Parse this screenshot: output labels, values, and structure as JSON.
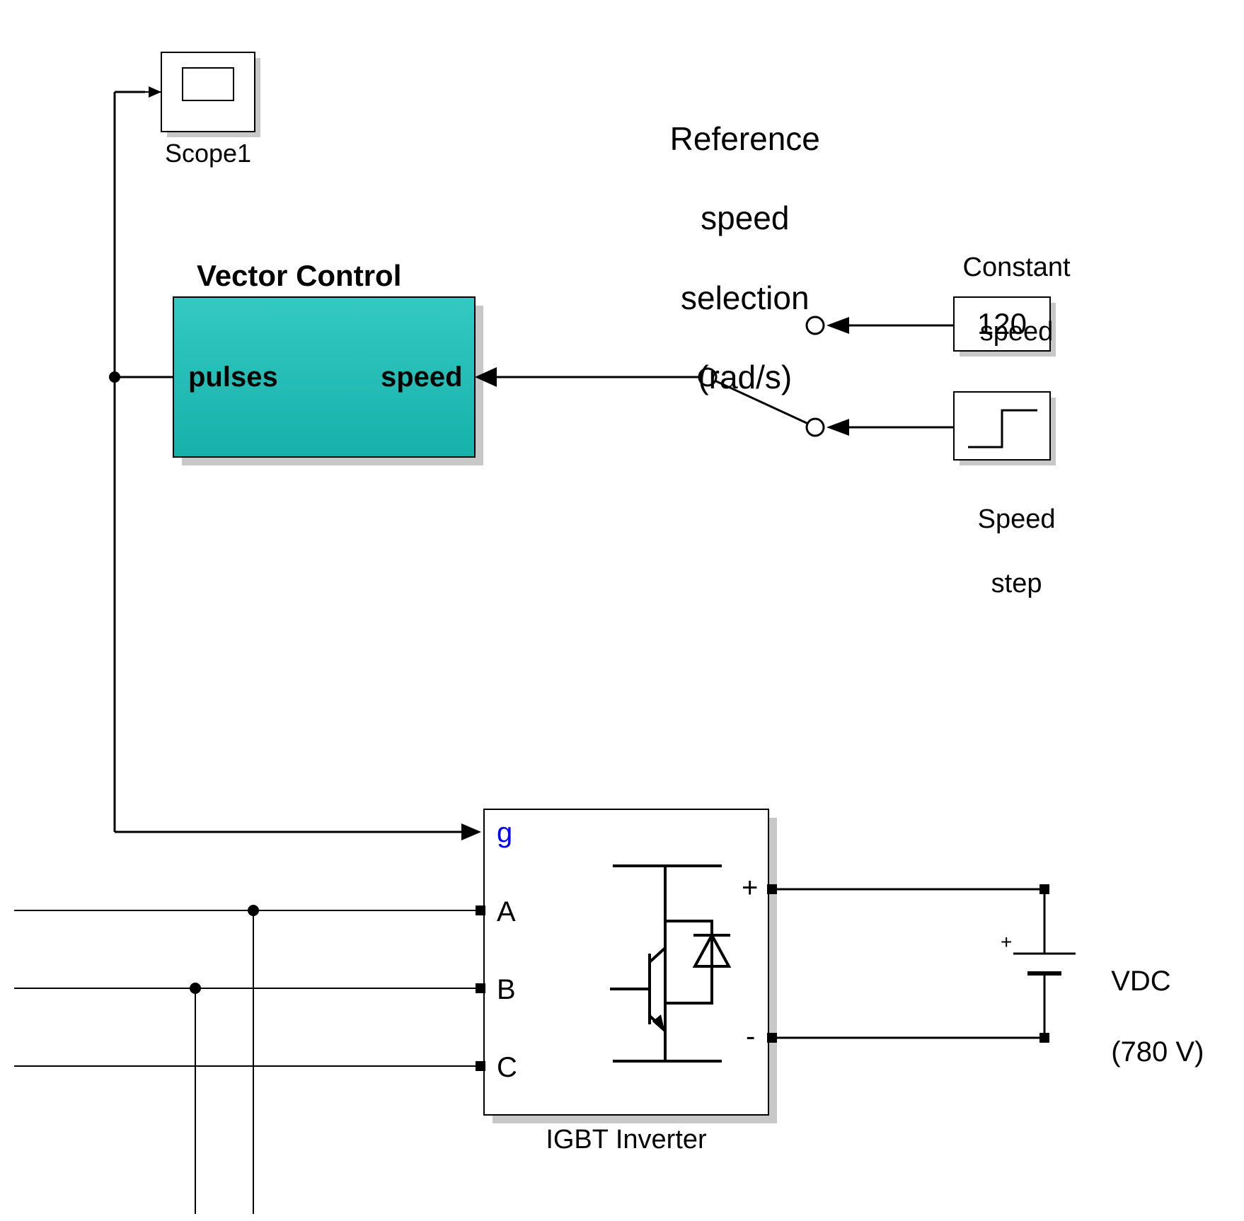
{
  "scope1": {
    "label": "Scope1"
  },
  "vector_control": {
    "title": "Vector Control",
    "port_out": "pulses",
    "port_in": "speed"
  },
  "reference_speed": {
    "title_line1": "Reference",
    "title_line2": "speed",
    "title_line3": "selection",
    "title_line4": "(rad/s)"
  },
  "constant_speed": {
    "label_line1": "Constant",
    "label_line2": "speed",
    "value": "120"
  },
  "speed_step": {
    "label_line1": "Speed",
    "label_line2": "step"
  },
  "inverter": {
    "label": "IGBT Inverter",
    "port_g": "g",
    "port_a": "A",
    "port_b": "B",
    "port_c": "C",
    "port_plus": "+",
    "port_minus": "-",
    "terminal_plus": "+"
  },
  "vdc": {
    "label_line1": "VDC",
    "label_line2": "(780 V)"
  },
  "colors": {
    "vector_fill_top": "#29c2bd",
    "vector_fill_bottom": "#1bb5af",
    "shadow": "#c8c8c8",
    "border": "#000000"
  }
}
